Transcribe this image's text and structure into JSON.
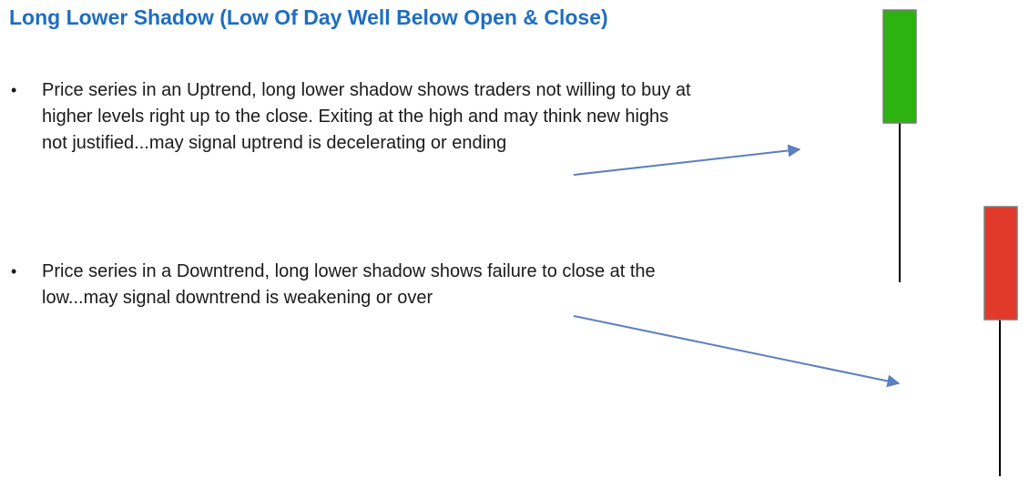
{
  "slide": {
    "title": "Long Lower Shadow (Low Of Day Well Below Open & Close)",
    "bullets": [
      {
        "marker": "•",
        "text": "Price series in an Uptrend, long lower shadow shows traders not willing to buy at higher levels right up to the close. Exiting at the high and may think new highs not justified...may signal uptrend is decelerating or ending"
      },
      {
        "marker": "•",
        "text": "Price series in a Downtrend, long lower shadow shows failure to close at the low...may signal downtrend is weakening or over"
      }
    ]
  },
  "colors": {
    "title": "#1f6ec0",
    "arrow": "#5b7fbf",
    "bullish_candle": "#2db30f",
    "bearish_candle": "#e23a2a",
    "wick": "#000000"
  },
  "candles": [
    {
      "name": "bullish-candle",
      "color": "green",
      "shadow": "long lower shadow"
    },
    {
      "name": "bearish-candle",
      "color": "red",
      "shadow": "long lower shadow"
    }
  ]
}
